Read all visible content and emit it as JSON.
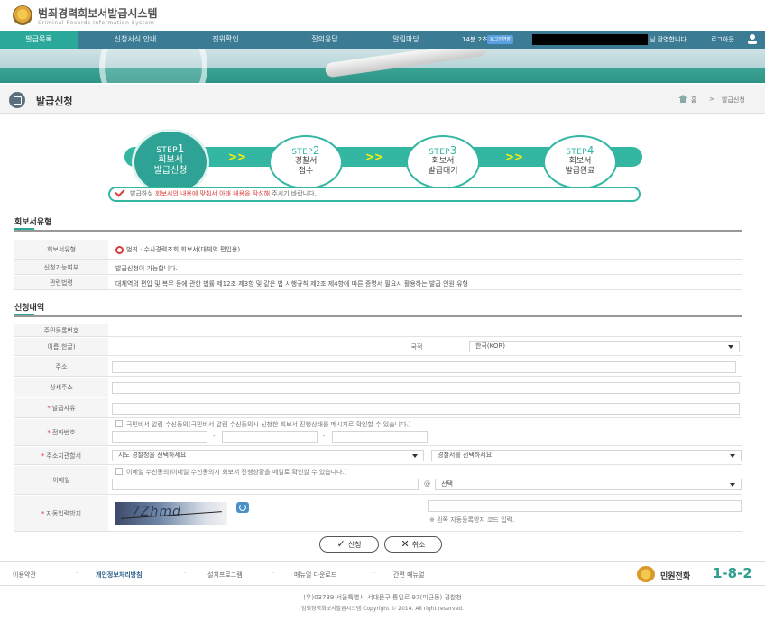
{
  "header": {
    "logo_title": "범죄경력회보서발급시스템",
    "logo_sub": "Criminal Records Information System"
  },
  "nav": {
    "items": [
      {
        "label": "발급목록"
      },
      {
        "label": "신청서식 안내"
      },
      {
        "label": "진위확인"
      },
      {
        "label": "질의응답"
      },
      {
        "label": "알림마당"
      }
    ],
    "timer": "14분 2초",
    "extend_label": "로그인연장",
    "welcome": "님 환영합니다.",
    "logout_label": "로그아웃"
  },
  "page": {
    "title": "발급신청",
    "breadcrumb": {
      "home": "홈",
      "sep": ">",
      "current": "발급신청"
    }
  },
  "steps": [
    {
      "label": "STEP",
      "num": "1",
      "line1": "회보서",
      "line2": "발급신청"
    },
    {
      "label": "STEP",
      "num": "2",
      "line1": "경찰서",
      "line2": "접수"
    },
    {
      "label": "STEP",
      "num": "3",
      "line1": "회보서",
      "line2": "발급대기"
    },
    {
      "label": "STEP",
      "num": "4",
      "line1": "회보서",
      "line2": "발급완료"
    }
  ],
  "notice": {
    "pre": "발급하실 ",
    "highlight": "회보서의 내용에 맞춰서 아래 내용을 작성해",
    "post": " 주시기 바랍니다."
  },
  "section1": {
    "title": "회보서유형",
    "rows": [
      {
        "label": "회보서유형",
        "value": "범죄 · 수사경력조회 회보서(대체역 편입용)"
      },
      {
        "label": "신청가능여부",
        "value": "발급신청이 가능합니다."
      },
      {
        "label": "관련법령",
        "value": "대체역의 편입 및 복무 등에 관한 법률 제12조 제3항 및 같은 법 시행규칙 제2조 제4항에 따른 증명서 필요시 활용하는 발급 인원 유형"
      }
    ]
  },
  "section2": {
    "title": "신청내역",
    "labels": {
      "rrn": "주민등록번호",
      "name": "이름(한글)",
      "nationality": "국적",
      "address": "주소",
      "address_detail": "상세주소",
      "reason": "발급사유",
      "phone": "전화번호",
      "police": "주소지관할서",
      "email": "이메일",
      "captcha": "자동입력방지"
    },
    "nationality_value": "한국(KOR)",
    "phone_consent": "국민비서 알림 수신동의(국민비서 알림 수신동의시 신청한 회보서 진행상태를 메시지로 확인할 수 있습니다.)",
    "phone_sep": "-",
    "police_placeholder": "시도 경찰청을 선택하세요",
    "station_placeholder": "경찰서를 선택하세요",
    "email_consent": "이메일 수신동의(이메일 수신동의시 회보서 진행상황을 메일로 확인할 수 있습니다.)",
    "email_at": "@",
    "email_domain": "선택",
    "captcha_text": "7Zhmd",
    "captcha_hint": "※ 왼쪽 자동등록방지 코드 입력."
  },
  "buttons": {
    "apply": "신청",
    "cancel": "취소"
  },
  "footer": {
    "links": [
      {
        "label": "이용약관"
      },
      {
        "label": "개인정보처리방침"
      },
      {
        "label": "설치프로그램"
      },
      {
        "label": "매뉴얼 다운로드"
      },
      {
        "label": "간편 매뉴얼"
      }
    ],
    "callcenter_label": "민원전화",
    "callcenter_number": "1-8-2",
    "address": "(우)03739 서울특별시 서대문구 통일로 97(미근동) 경찰청",
    "copyright": "범죄경력회보서발급시스템 Copyright © 2014. All right reserved."
  }
}
